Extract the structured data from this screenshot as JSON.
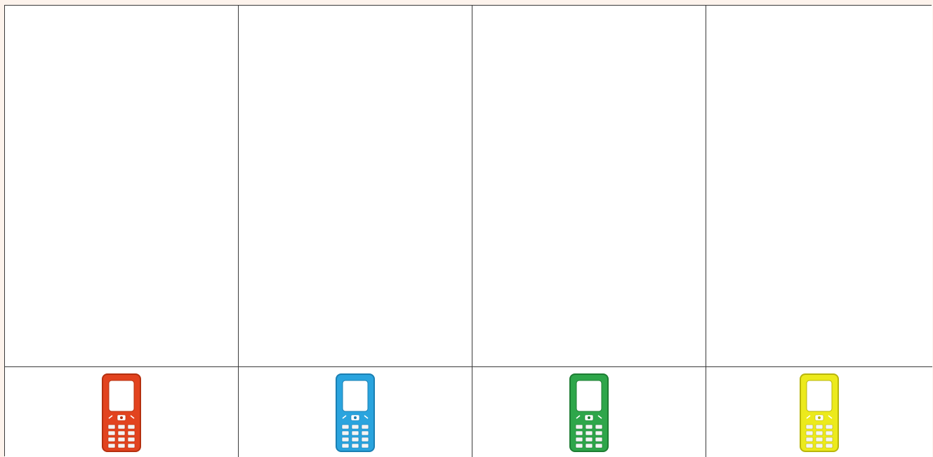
{
  "grid": {
    "columns": 4,
    "rows": 2,
    "phones": [
      {
        "icon": "phone-icon",
        "color": "#e2431f",
        "dark": "#b5300f"
      },
      {
        "icon": "phone-icon",
        "color": "#2aa4de",
        "dark": "#1a7fb3"
      },
      {
        "icon": "phone-icon",
        "color": "#2ea64a",
        "dark": "#1d7d33"
      },
      {
        "icon": "phone-icon",
        "color": "#ecea1c",
        "dark": "#b9b60c"
      }
    ]
  }
}
